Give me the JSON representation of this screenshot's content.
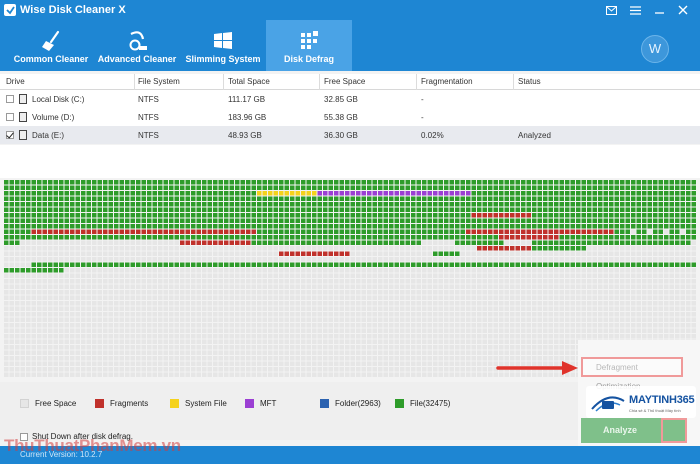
{
  "app": {
    "title": "Wise Disk Cleaner X",
    "avatar_letter": "W"
  },
  "tabs": [
    {
      "label": "Common Cleaner",
      "icon": "broom-icon",
      "active": false
    },
    {
      "label": "Advanced Cleaner",
      "icon": "vacuum-icon",
      "active": false
    },
    {
      "label": "Slimming System",
      "icon": "windows-icon",
      "active": false
    },
    {
      "label": "Disk Defrag",
      "icon": "defrag-icon",
      "active": true
    }
  ],
  "table": {
    "columns": [
      "Drive",
      "File System",
      "Total Space",
      "Free Space",
      "Fragmentation",
      "Status"
    ],
    "rows": [
      {
        "drive": "Local Disk (C:)",
        "fs": "NTFS",
        "total": "111.17 GB",
        "free": "32.85 GB",
        "frag": "-",
        "status": "",
        "checked": false,
        "selected": false
      },
      {
        "drive": "Volume (D:)",
        "fs": "NTFS",
        "total": "183.96 GB",
        "free": "55.38 GB",
        "frag": "-",
        "status": "",
        "checked": false,
        "selected": false
      },
      {
        "drive": "Data (E:)",
        "fs": "NTFS",
        "total": "48.93 GB",
        "free": "36.30 GB",
        "frag": "0.02%",
        "status": "Analyzed",
        "checked": true,
        "selected": true
      }
    ]
  },
  "legend": [
    {
      "label": "Free Space",
      "color": "#e6e6e6"
    },
    {
      "label": "Fragments",
      "color": "#c0312b"
    },
    {
      "label": "System File",
      "color": "#f5d21c"
    },
    {
      "label": "MFT",
      "color": "#9b3fd3"
    },
    {
      "label": "Folder(2963)",
      "color": "#2b62b0"
    },
    {
      "label": "File(32475)",
      "color": "#2e9c2a"
    }
  ],
  "options": {
    "shutdown_label": "Shut Down after disk defrag."
  },
  "actions": {
    "defragment_label": "Defragment",
    "optimization_label": "Optimization",
    "analyze_label": "Analyze"
  },
  "status": {
    "text": "Current Version: 10.2.7"
  },
  "watermarks": {
    "brand": "MAYTINH365",
    "brand_sub": "Chia sẻ & Thủ thuật Máy tính",
    "site": "ThuThuatPhanMem.vn"
  },
  "colors": {
    "header": "#1e86d3",
    "active_tab": "#4aa3e6",
    "free_block": "#e6e6e6",
    "file_block": "#2e9c2a",
    "fragment_block": "#c0312b",
    "system_block": "#f5d21c",
    "mft_block": "#9b3fd3",
    "analyze_button": "#7fc08a",
    "highlight_border": "#f09a9a"
  }
}
